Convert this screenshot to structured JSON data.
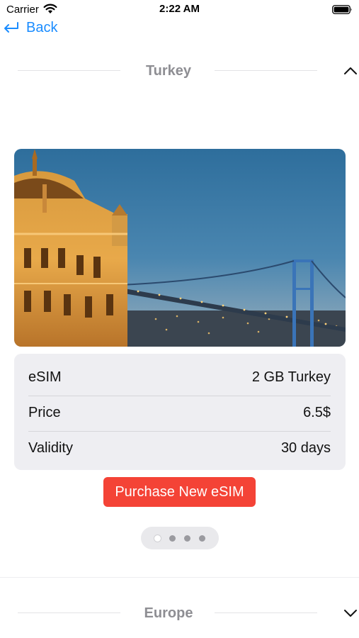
{
  "status_bar": {
    "carrier": "Carrier",
    "time": "2:22 AM"
  },
  "nav": {
    "back_label": "Back"
  },
  "sections": [
    {
      "title": "Turkey",
      "expanded": true
    },
    {
      "title": "Europe",
      "expanded": false
    }
  ],
  "plan": {
    "rows": [
      {
        "label": "eSIM",
        "value": "2 GB Turkey"
      },
      {
        "label": "Price",
        "value": "6.5$"
      },
      {
        "label": "Validity",
        "value": "30 days"
      }
    ],
    "purchase_label": "Purchase New eSIM"
  },
  "carousel": {
    "pages": 4,
    "current_page": 1
  },
  "colors": {
    "accent": "#1a8cff",
    "purchase": "#f44336",
    "card": "#eeeef2"
  }
}
